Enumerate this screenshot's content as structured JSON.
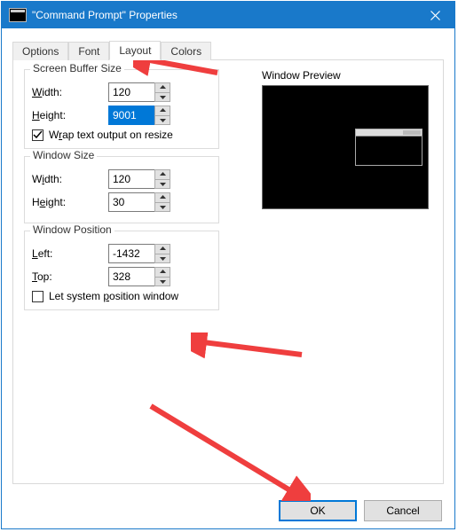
{
  "window": {
    "title": "\"Command Prompt\" Properties"
  },
  "tabs": {
    "options": "Options",
    "font": "Font",
    "layout": "Layout",
    "colors": "Colors",
    "active": "layout"
  },
  "screenBuffer": {
    "legend": "Screen Buffer Size",
    "widthLabel_u": "W",
    "widthLabel_rest": "idth:",
    "widthValue": "120",
    "heightLabel_u": "H",
    "heightLabel_rest": "eight:",
    "heightValue": "9001",
    "wrapLabel_pre": "W",
    "wrapLabel_u": "r",
    "wrapLabel_post": "ap text output on resize",
    "wrapChecked": true
  },
  "windowSize": {
    "legend": "Window Size",
    "widthLabel_pre": "W",
    "widthLabel_u": "i",
    "widthLabel_post": "dth:",
    "widthValue": "120",
    "heightLabel_pre": "H",
    "heightLabel_u": "e",
    "heightLabel_post": "ight:",
    "heightValue": "30"
  },
  "windowPosition": {
    "legend": "Window Position",
    "leftLabel_u": "L",
    "leftLabel_rest": "eft:",
    "leftValue": "-1432",
    "topLabel_u": "T",
    "topLabel_rest": "op:",
    "topValue": "328",
    "sysPosLabel_pre": "Let system ",
    "sysPosLabel_u": "p",
    "sysPosLabel_post": "osition window",
    "sysPosChecked": false
  },
  "preview": {
    "label": "Window Preview"
  },
  "buttons": {
    "ok": "OK",
    "cancel": "Cancel"
  }
}
